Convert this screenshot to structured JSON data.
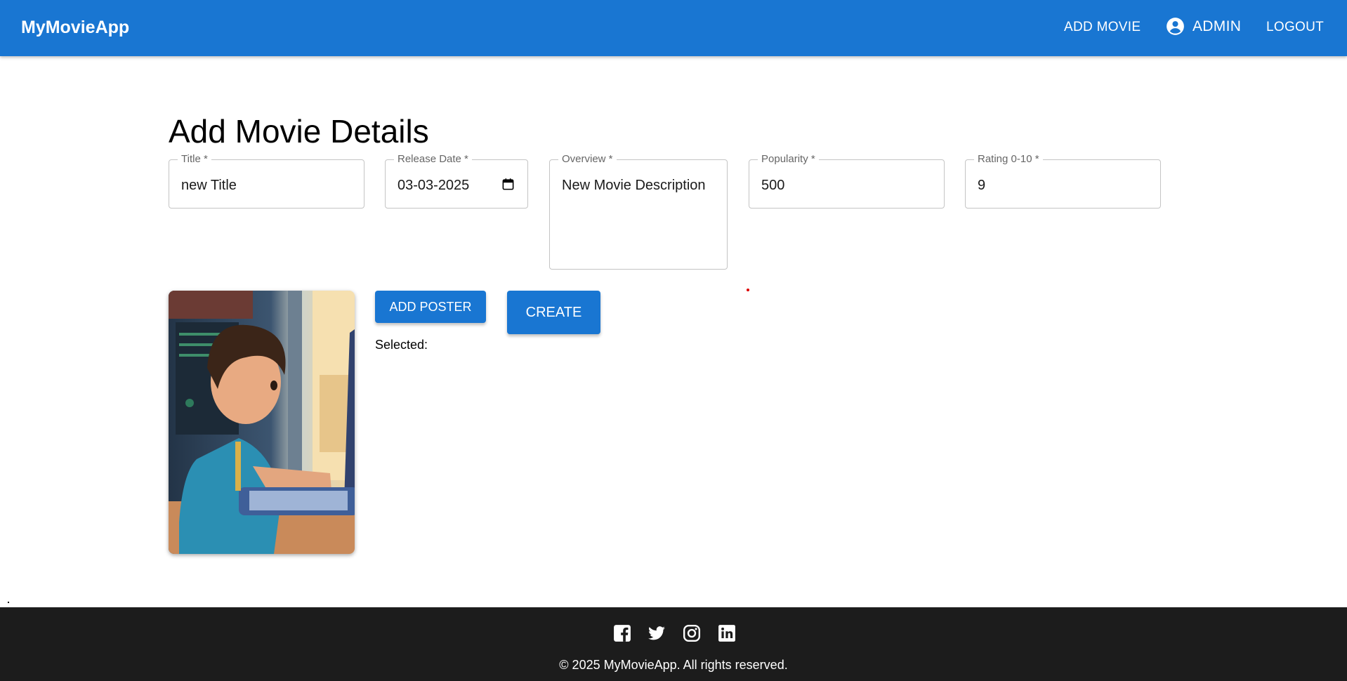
{
  "appbar": {
    "brand": "MyMovieApp",
    "add_movie": "ADD MOVIE",
    "admin": "ADMIN",
    "logout": "LOGOUT"
  },
  "page": {
    "title": "Add Movie Details"
  },
  "form": {
    "title": {
      "label": "Title *",
      "value": "new Title"
    },
    "release_date": {
      "label": "Release Date *",
      "value": "03-03-2025"
    },
    "overview": {
      "label": "Overview *",
      "value": "New Movie Description"
    },
    "popularity": {
      "label": "Popularity *",
      "value": "500"
    },
    "rating": {
      "label": "Rating 0-10 *",
      "value": "9"
    }
  },
  "poster": {
    "image": "boy-typing-on-computer-illustration"
  },
  "actions": {
    "add_poster": "ADD POSTER",
    "create": "CREATE",
    "selected_label": "Selected:"
  },
  "footer": {
    "icons": [
      "facebook-icon",
      "twitter-icon",
      "instagram-icon",
      "linkedin-icon"
    ],
    "copyright": "© 2025 MyMovieApp. All rights reserved."
  },
  "colors": {
    "primary": "#1976d2",
    "footer_bg": "#1c1c1c"
  }
}
